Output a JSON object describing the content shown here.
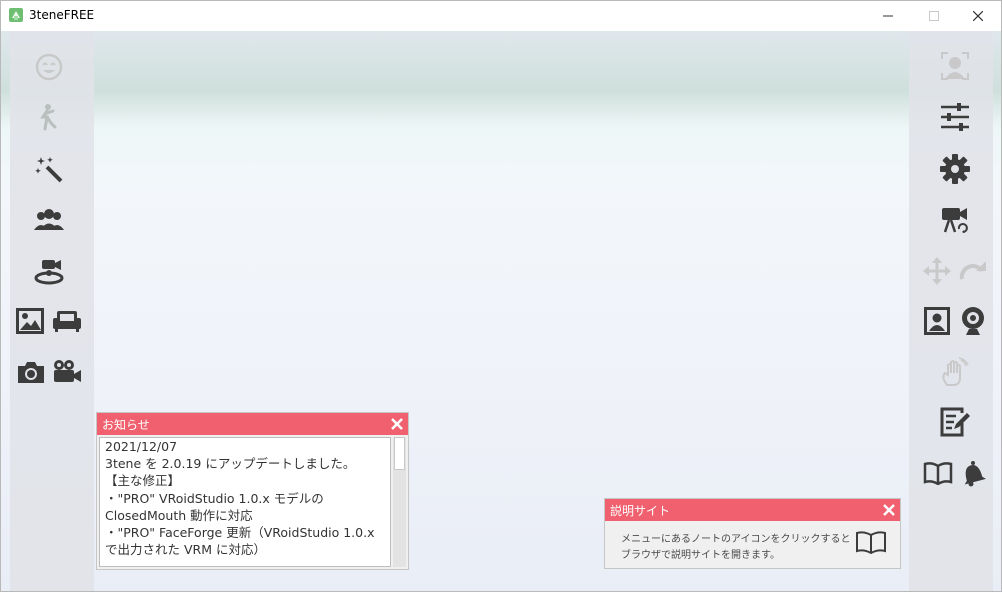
{
  "window": {
    "title": "3teneFREE",
    "controls": {
      "minimize_icon": "minimize-icon",
      "maximize_icon": "maximize-icon",
      "close_icon": "close-icon"
    }
  },
  "left_sidebar": {
    "items": [
      {
        "icon": "face-icon",
        "enabled": false
      },
      {
        "icon": "pose-icon",
        "enabled": false
      },
      {
        "icon": "magic-wand-icon",
        "enabled": true
      },
      {
        "icon": "group-icon",
        "enabled": true
      },
      {
        "icon": "stage-camera-icon",
        "enabled": true
      },
      {
        "icon": "background-image-icon",
        "enabled": true
      },
      {
        "icon": "sofa-icon",
        "enabled": true
      },
      {
        "icon": "camera-icon",
        "enabled": true
      },
      {
        "icon": "video-camera-icon",
        "enabled": true
      }
    ]
  },
  "right_sidebar": {
    "items": [
      {
        "icon": "face-tracking-icon",
        "enabled": false
      },
      {
        "icon": "sliders-icon",
        "enabled": true
      },
      {
        "icon": "gear-icon",
        "enabled": true
      },
      {
        "icon": "camera-rotate-icon",
        "enabled": true
      },
      {
        "icon": "move-arrows-icon",
        "enabled": false
      },
      {
        "icon": "redo-icon",
        "enabled": false
      },
      {
        "icon": "portrait-icon",
        "enabled": true
      },
      {
        "icon": "webcam-icon",
        "enabled": true
      },
      {
        "icon": "hand-wave-icon",
        "enabled": false
      },
      {
        "icon": "notes-edit-icon",
        "enabled": true
      },
      {
        "icon": "book-icon",
        "enabled": true
      },
      {
        "icon": "bell-icon",
        "enabled": true
      }
    ]
  },
  "notice_panel": {
    "title": "お知らせ",
    "lines": [
      "2021/12/07",
      "3tene を 2.0.19 にアップデートしました。",
      "【主な修正】",
      "・\"PRO\" VRoidStudio 1.0.x モデルの",
      "ClosedMouth 動作に対応",
      "・\"PRO\" FaceForge 更新（VRoidStudio 1.0.x",
      "で出力された VRM に対応）"
    ]
  },
  "help_panel": {
    "title": "説明サイト",
    "line1": "メニューにあるノートのアイコンをクリックすると",
    "line2": "ブラウザで説明サイトを開きます。"
  },
  "colors": {
    "panel_header": "#f0606e",
    "icon_dark": "#3c3c3c",
    "icon_disabled": "#c8c8c8"
  }
}
